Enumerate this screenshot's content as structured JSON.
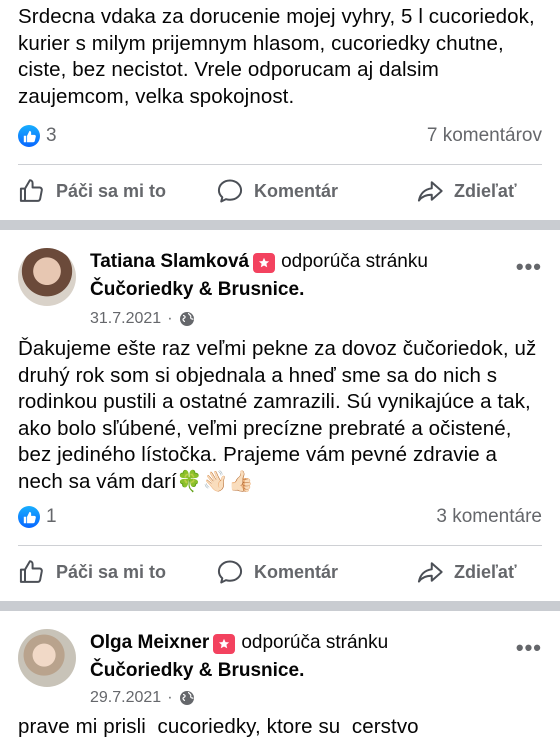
{
  "post1": {
    "text": "Srdecna vdaka za dorucenie mojej vyhry, 5 l cucoriedok, kurier s milym prijemnym hlasom, cucoriedky chutne, ciste, bez necistot. Vrele odporucam aj dalsim zaujemcom, velka spokojnost.",
    "likes": "3",
    "comments": "7 komentárov"
  },
  "actions": {
    "like": "Páči sa mi to",
    "comment": "Komentár",
    "share": "Zdieľať"
  },
  "post2": {
    "author": "Tatiana Slamková",
    "recommends": "odporúča stránku",
    "page": "Čučoriedky & Brusnice",
    "date": "31.7.2021",
    "text": "Ďakujeme ešte raz veľmi pekne za dovoz čučoriedok, už druhý rok som si objednala a hneď sme sa do nich s rodinkou pustili a ostatné zamrazili. Sú vynikajúce a tak, ako bolo sľúbené, veľmi precízne prebraté a očistené, bez jediného lístočka. Prajeme vám pevné zdravie a nech sa vám darí🍀👋🏻👍🏻",
    "likes": "1",
    "comments": "3 komentáre"
  },
  "post3": {
    "author": "Olga Meixner",
    "recommends": "odporúča stránku",
    "page": "Čučoriedky & Brusnice",
    "date": "29.7.2021",
    "text": "prave mi prisli  cucoriedky, ktore su  cerstvo"
  },
  "icons": [
    "like-icon",
    "comment-icon",
    "share-icon",
    "globe-icon",
    "more-icon",
    "recommend-badge-icon"
  ],
  "colors": {
    "accent": "#0866ff",
    "badge": "#f3425f",
    "muted": "#65676b",
    "separator": "#c9ccd1"
  }
}
